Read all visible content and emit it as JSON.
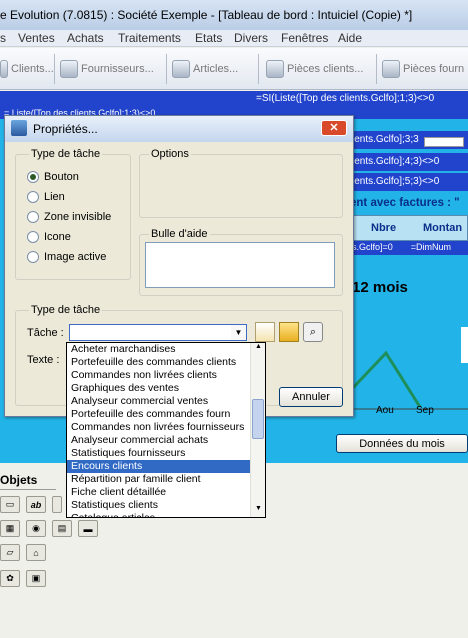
{
  "window": {
    "title": "e Evolution (7.0815) : Société Exemple - [Tableau de bord : Intuiciel (Copie) *]"
  },
  "menu": [
    "Ventes",
    "Achats",
    "Traitements",
    "Etats",
    "Divers",
    "Fenêtres",
    "Aide"
  ],
  "toolbar": {
    "items": [
      "Clients...",
      "Fournisseurs...",
      "Articles...",
      "Pièces clients...",
      "Pièces fourn"
    ]
  },
  "dashboard": {
    "formulas": [
      "=SI(Liste([Top des clients.Gclfo];1;3)<>0",
      "...(Liste([Top des clients.Gclfo];2;3)<>0",
      "ients.Gclfo];3;3",
      "ients.Gclfo];4;3)<>0",
      "ients.Gclfo];5;3)<>0",
      "= Liste([Top des clients.Gclfo];1;3)<>0"
    ],
    "factures_header": "ent avec factures : \"",
    "col_nbre": "Nbre",
    "col_montant": "Montan",
    "row_left": "s.Gclfo]=0",
    "row_right": "=DimNum",
    "months_title": "12 mois",
    "months": [
      "Aou",
      "Sep"
    ],
    "btn_donnees": "Données du mois"
  },
  "dialog": {
    "title": "Propriétés...",
    "type_group": "Type de tâche",
    "options_group": "Options",
    "radios": [
      {
        "label": "Bouton",
        "checked": true
      },
      {
        "label": "Lien",
        "checked": false
      },
      {
        "label": "Zone invisible",
        "checked": false
      },
      {
        "label": "Icone",
        "checked": false
      },
      {
        "label": "Image active",
        "checked": false
      }
    ],
    "bulle_label": "Bulle d'aide",
    "type_group2": "Type de tâche",
    "tache_label": "Tâche :",
    "texte_label": "Texte :",
    "annuler": "Annuler"
  },
  "dropdown": {
    "items": [
      "Acheter marchandises",
      "Portefeuille des commandes clients",
      "Commandes non livrées clients",
      "Graphiques des ventes",
      "Analyseur commercial ventes",
      "Portefeuille des commandes fourn",
      "Commandes non livrées fournisseurs",
      "Analyseur commercial achats",
      "Statistiques fournisseurs",
      "Encours clients",
      "Répartition par famille client",
      "Fiche client détaillée",
      "Statistiques clients",
      "Catalogue articles"
    ],
    "selected_index": 9
  },
  "objects": {
    "title": "Objets"
  },
  "colors": {
    "dash_bg": "#22b4e8",
    "dark_blue": "#2244cc",
    "selection": "#316ac5",
    "green_line": "#1e8e5a"
  }
}
